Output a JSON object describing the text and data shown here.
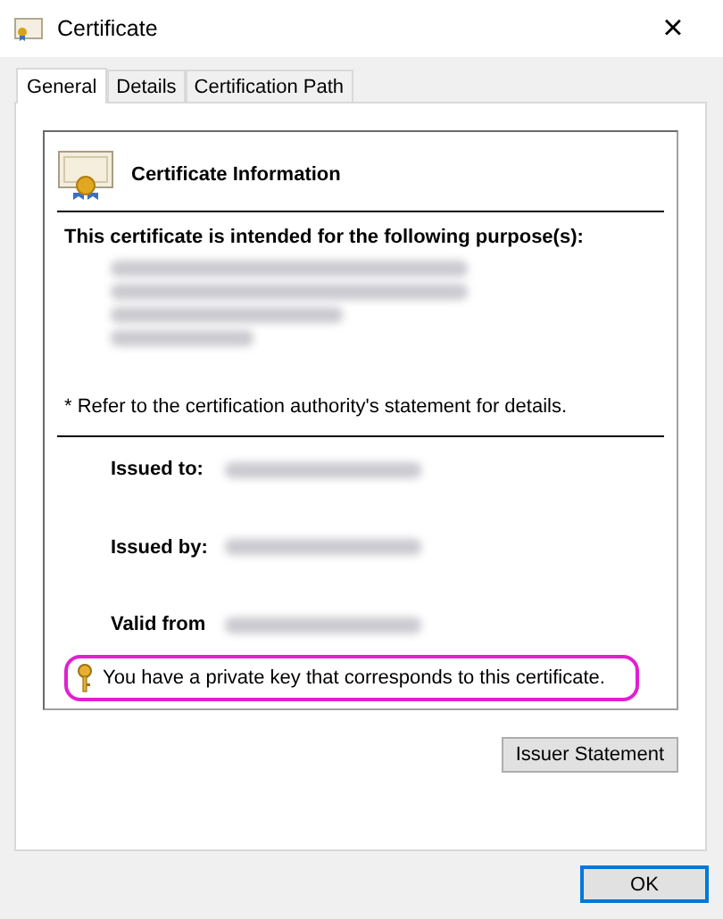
{
  "window": {
    "title": "Certificate",
    "close": "×"
  },
  "tabs": [
    {
      "label": "General",
      "selected": true
    },
    {
      "label": "Details",
      "selected": false
    },
    {
      "label": "Certification Path",
      "selected": false
    }
  ],
  "info": {
    "title": "Certificate Information",
    "purpose_heading": "This certificate is intended for the following purpose(s):",
    "purposes": [
      {
        "kind": "redacted"
      },
      {
        "kind": "redacted"
      },
      {
        "kind": "redacted"
      },
      {
        "kind": "redacted"
      }
    ],
    "note": "* Refer to the certification authority's statement for details.",
    "fields": [
      {
        "label": "Issued to:",
        "kind": "redacted"
      },
      {
        "label": "Issued by:",
        "kind": "redacted"
      },
      {
        "label": "Valid from",
        "kind": "redacted"
      }
    ],
    "private_key": {
      "text": "You have a private key that corresponds to this certificate.",
      "highlighted": true
    }
  },
  "issuer_button": "Issuer Statement",
  "ok_button": {
    "label": "OK",
    "default": true
  }
}
